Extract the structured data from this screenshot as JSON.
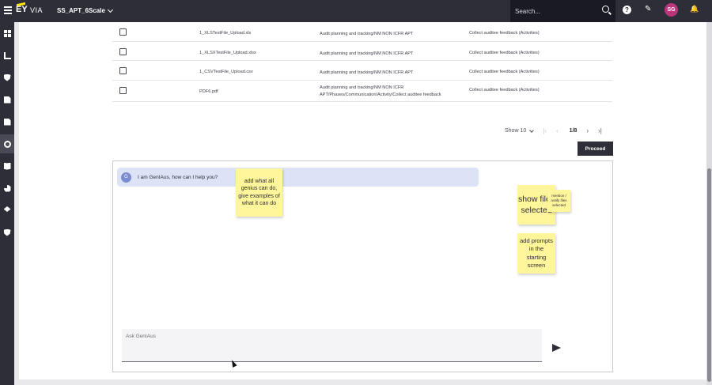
{
  "header": {
    "logo_ey": "EY",
    "logo_via": "VIA",
    "project_name": "SS_APT_6Scale",
    "search_placeholder": "Search...",
    "help_glyph": "?",
    "edit_glyph": "✎",
    "user_initials": "SG",
    "user_avatar_color": "#b9367a",
    "bell_glyph": "🔔"
  },
  "sidebar": {
    "items": [
      {
        "icon": "dashboard-icon"
      },
      {
        "icon": "chart-icon"
      },
      {
        "icon": "shield-icon"
      },
      {
        "icon": "document-icon"
      },
      {
        "icon": "workflow-icon"
      },
      {
        "icon": "settings-circle-icon",
        "active": true
      },
      {
        "icon": "library-icon"
      },
      {
        "icon": "pie-icon"
      },
      {
        "icon": "layers-icon"
      },
      {
        "icon": "security-icon"
      }
    ]
  },
  "files": {
    "rows": [
      {
        "name": "1_XLSTestFile_Upload.xls",
        "path": "Audit planning and tracking/NM NON ICFR APT",
        "step": "Collect auditee feedback (Activities)"
      },
      {
        "name": "1_XLSXTestFile_Upload.xlsx",
        "path": "Audit planning and tracking/NM NON ICFR APT",
        "step": "Collect auditee feedback (Activities)"
      },
      {
        "name": "1_CSVTestFile_Upload.csv",
        "path": "Audit planning and tracking/NM NON ICFR APT",
        "step": "Collect auditee feedback (Activities)"
      },
      {
        "name": "PDF6.pdf",
        "path": "Audit planning and tracking/NM NON ICFR APT/Phases/Communication/Activity/Collect auditee feedback",
        "step": "Collect auditee feedback (Activities)"
      }
    ]
  },
  "pagination": {
    "show_label": "Show 10",
    "first_glyph": "|‹",
    "prev_glyph": "‹",
    "page_count": "1/8",
    "next_glyph": "›",
    "last_glyph": "›|"
  },
  "actions": {
    "proceed_label": "Proceed"
  },
  "chat": {
    "bot_initial": "G",
    "greeting": "I am GenIAus, how can I help you?",
    "input_placeholder": "Ask GenIAus"
  },
  "stickies": {
    "note1": "add what all genius can do, give examples of what it can do",
    "note2": "show files selected",
    "note3": "mention / notify files selected",
    "note4": "add prompts in the starting screen",
    "color": "#fff59a"
  },
  "theme": {
    "dark": "#2e2e38",
    "accent_yellow": "#ffe600",
    "bubble_blue": "#dce3f6"
  }
}
